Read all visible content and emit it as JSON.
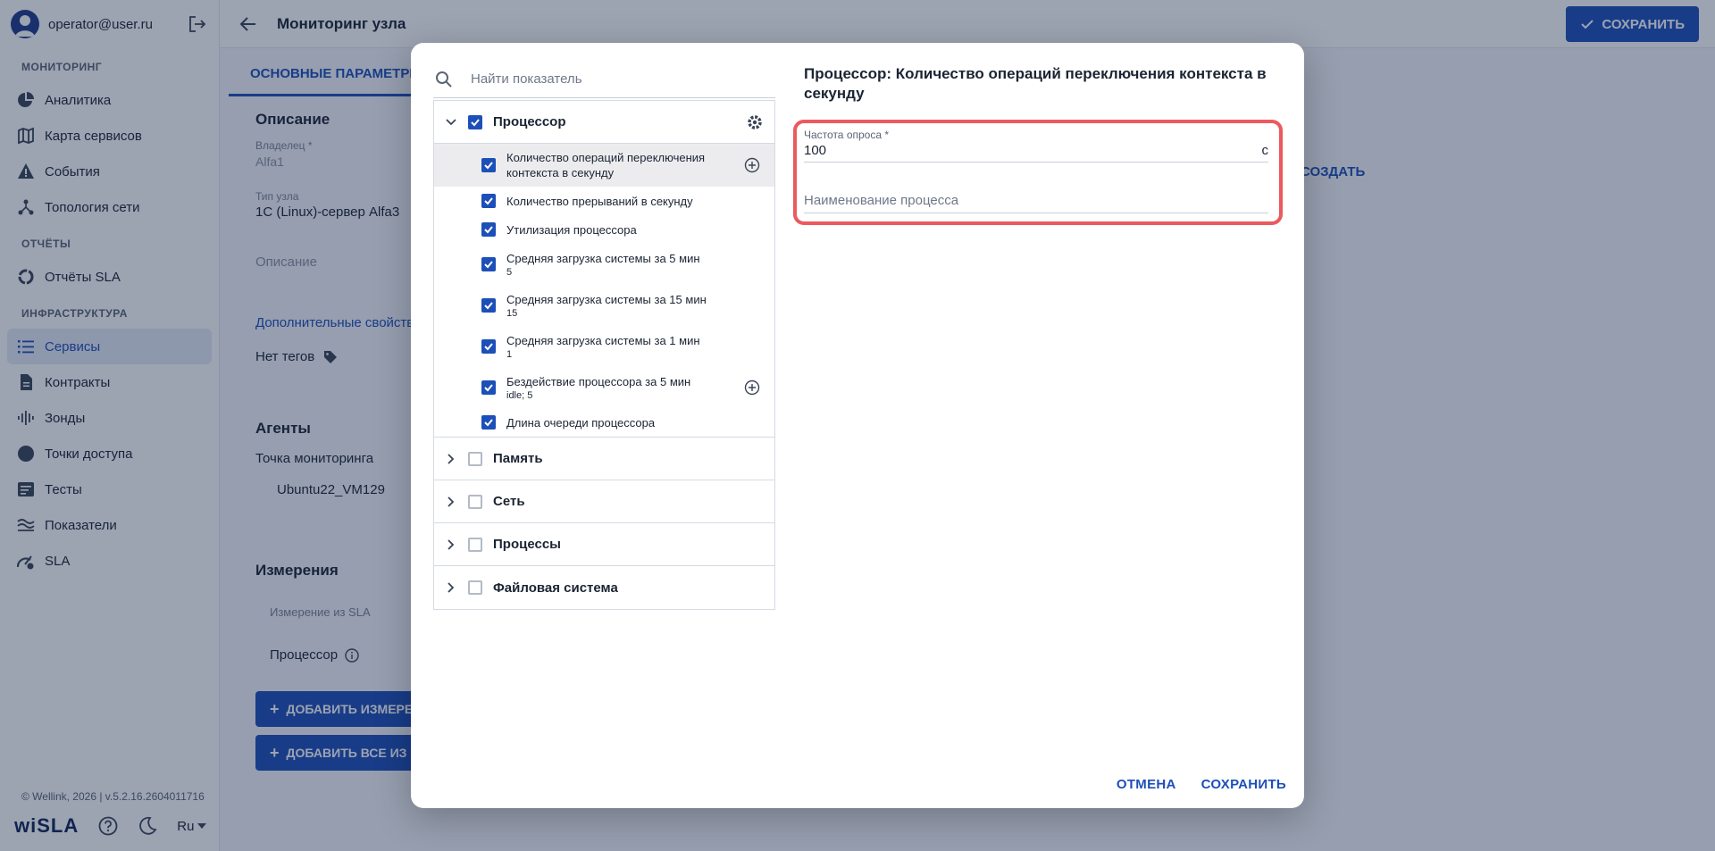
{
  "user": {
    "email": "operator@user.ru"
  },
  "sidebar": {
    "sections": [
      {
        "title": "МОНИТОРИНГ",
        "items": [
          {
            "label": "Аналитика",
            "icon": "pie-chart-icon"
          },
          {
            "label": "Карта сервисов",
            "icon": "map-icon"
          },
          {
            "label": "События",
            "icon": "warning-icon"
          },
          {
            "label": "Топология сети",
            "icon": "topology-icon"
          }
        ]
      },
      {
        "title": "ОТЧЁТЫ",
        "items": [
          {
            "label": "Отчёты SLA",
            "icon": "donut-icon"
          }
        ]
      },
      {
        "title": "ИНФРАСТРУКТУРА",
        "items": [
          {
            "label": "Сервисы",
            "icon": "list-icon",
            "active": true
          },
          {
            "label": "Контракты",
            "icon": "document-icon"
          },
          {
            "label": "Зонды",
            "icon": "signal-icon"
          },
          {
            "label": "Точки доступа",
            "icon": "circle-icon"
          },
          {
            "label": "Тесты",
            "icon": "tests-icon"
          },
          {
            "label": "Показатели",
            "icon": "metrics-icon"
          },
          {
            "label": "SLA",
            "icon": "sla-icon"
          }
        ]
      }
    ],
    "copyright": "© Wellink, 2026 | v.5.2.16.2604011716",
    "logo": "wiSLA",
    "lang": "Ru"
  },
  "page": {
    "title": "Мониторинг узла",
    "save_label": "СОХРАНИТЬ",
    "tab": "ОСНОВНЫЕ ПАРАМЕТРЫ",
    "description_title": "Описание",
    "owner_label": "Владелец *",
    "owner_value": "Alfa1",
    "node_type_label": "Тип узла",
    "node_type_value": "1С (Linux)-сервер Alfa3",
    "description_placeholder": "Описание",
    "extra_props": "Дополнительные свойства",
    "no_tags": "Нет тегов",
    "agents_title": "Агенты",
    "monitoring_point": "Точка мониторинга",
    "agent_value": "Ubuntu22_VM129",
    "measurements_title": "Измерения",
    "measurement_col": "Измерение из SLA",
    "measurement_value": "Процессор",
    "add_measurement": "ДОБАВИТЬ ИЗМЕРЕ",
    "add_all": "ДОБАВИТЬ ВСЕ ИЗ",
    "create": "СОЗДАТЬ"
  },
  "modal": {
    "search_placeholder": "Найти показатель",
    "groups": [
      {
        "label": "Процессор",
        "checked": true,
        "expanded": true
      },
      {
        "label": "Память",
        "checked": false
      },
      {
        "label": "Сеть",
        "checked": false
      },
      {
        "label": "Процессы",
        "checked": false
      },
      {
        "label": "Файловая система",
        "checked": false
      }
    ],
    "cpu_items": [
      {
        "label": "Количество операций переключения контекста в секунду",
        "sub": ""
      },
      {
        "label": "Количество прерываний в секунду",
        "sub": ""
      },
      {
        "label": "Утилизация процессора",
        "sub": ""
      },
      {
        "label": "Средняя загрузка системы за 5 мин",
        "sub": "5"
      },
      {
        "label": "Средняя загрузка системы за 15 мин",
        "sub": "15"
      },
      {
        "label": "Средняя загрузка системы за 1 мин",
        "sub": "1"
      },
      {
        "label": "Бездействие процессора за 5 мин",
        "sub": "idle; 5"
      },
      {
        "label": "Длина очереди процессора",
        "sub": ""
      }
    ],
    "detail_title": "Процессор: Количество операций переключения контекста в секунду",
    "poll_label": "Частота опроса *",
    "poll_value": "100",
    "poll_unit": "с",
    "process_placeholder": "Наименование процесса",
    "cancel": "ОТМЕНА",
    "save": "СОХРАНИТЬ"
  }
}
